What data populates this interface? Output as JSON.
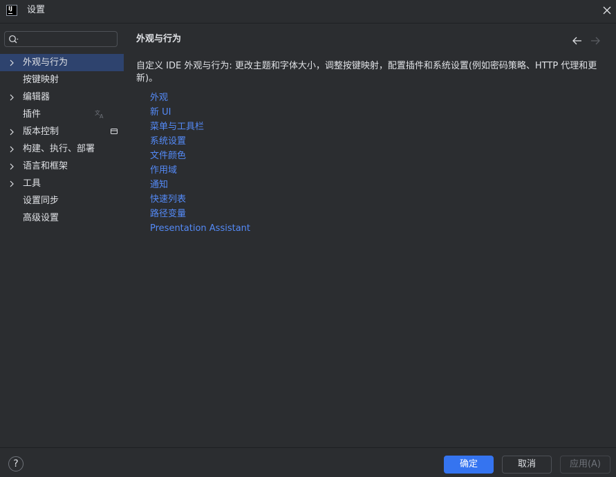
{
  "window": {
    "title": "设置"
  },
  "search": {
    "placeholder": "",
    "value": ""
  },
  "sidebar": {
    "items": [
      {
        "label": "外观与行为",
        "expandable": true,
        "selected": true
      },
      {
        "label": "按键映射",
        "expandable": false,
        "selected": false
      },
      {
        "label": "编辑器",
        "expandable": true,
        "selected": false
      },
      {
        "label": "插件",
        "expandable": false,
        "selected": false,
        "trailing_icon": "translate-icon"
      },
      {
        "label": "版本控制",
        "expandable": true,
        "selected": false,
        "trailing_icon": "project-level-icon"
      },
      {
        "label": "构建、执行、部署",
        "expandable": true,
        "selected": false
      },
      {
        "label": "语言和框架",
        "expandable": true,
        "selected": false
      },
      {
        "label": "工具",
        "expandable": true,
        "selected": false
      },
      {
        "label": "设置同步",
        "expandable": false,
        "selected": false
      },
      {
        "label": "高级设置",
        "expandable": false,
        "selected": false
      }
    ]
  },
  "main": {
    "title": "外观与行为",
    "description": "自定义 IDE 外观与行为: 更改主题和字体大小，调整按键映射，配置插件和系统设置(例如密码策略、HTTP 代理和更新)。",
    "links": [
      "外观",
      "新 UI",
      "菜单与工具栏",
      "系统设置",
      "文件颜色",
      "作用域",
      "通知",
      "快速列表",
      "路径变量",
      "Presentation Assistant"
    ]
  },
  "footer": {
    "help_label": "?",
    "ok_label": "确定",
    "cancel_label": "取消",
    "apply_label": "应用(A)"
  },
  "colors": {
    "background": "#2b2d30",
    "selection": "#2e436e",
    "link": "#548af7",
    "primary_button": "#3574f0",
    "text": "#dfe1e5"
  }
}
